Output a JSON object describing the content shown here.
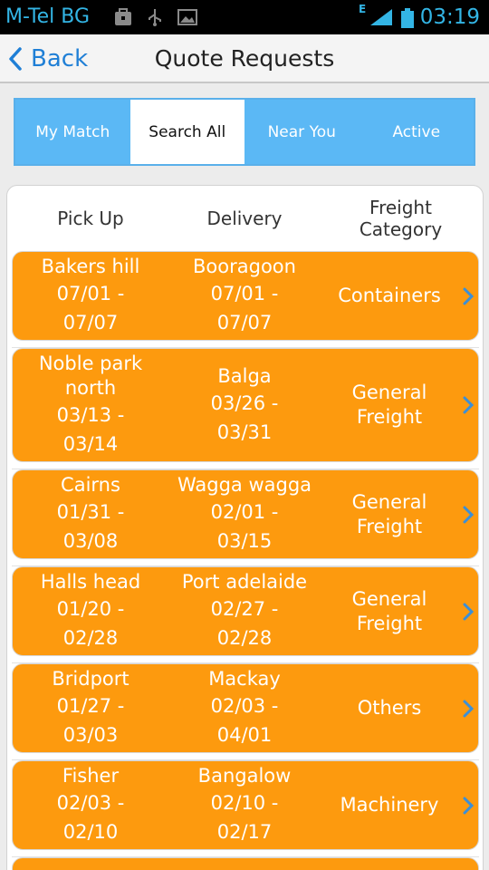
{
  "status_bar": {
    "carrier": "M-Tel BG",
    "time": "03:19",
    "network_type": "E",
    "icons": [
      "bag-icon",
      "usb-icon",
      "image-icon",
      "signal-icon",
      "battery-icon"
    ]
  },
  "header": {
    "back_label": "Back",
    "title": "Quote Requests"
  },
  "tabs": [
    {
      "label": "My Match",
      "active": false
    },
    {
      "label": "Search All",
      "active": true
    },
    {
      "label": "Near You",
      "active": false
    },
    {
      "label": "Active",
      "active": false
    }
  ],
  "columns": {
    "pick_up": "Pick Up",
    "delivery": "Delivery",
    "freight_category_line1": "Freight",
    "freight_category_line2": "Category"
  },
  "rows": [
    {
      "pick_place": "Bakers hill",
      "pick_dates_1": "07/01 -",
      "pick_dates_2": "07/07",
      "deliv_place": "Booragoon",
      "deliv_dates_1": "07/01 -",
      "deliv_dates_2": "07/07",
      "category": "Containers"
    },
    {
      "pick_place": "Noble park north",
      "pick_dates_1": "03/13 -",
      "pick_dates_2": "03/14",
      "deliv_place": "Balga",
      "deliv_dates_1": "03/26 -",
      "deliv_dates_2": "03/31",
      "category": "General Freight"
    },
    {
      "pick_place": "Cairns",
      "pick_dates_1": "01/31 -",
      "pick_dates_2": "03/08",
      "deliv_place": "Wagga wagga",
      "deliv_dates_1": "02/01 -",
      "deliv_dates_2": "03/15",
      "category": "General Freight"
    },
    {
      "pick_place": "Halls head",
      "pick_dates_1": "01/20 -",
      "pick_dates_2": "02/28",
      "deliv_place": "Port adelaide",
      "deliv_dates_1": "02/27 -",
      "deliv_dates_2": "02/28",
      "category": "General Freight"
    },
    {
      "pick_place": "Bridport",
      "pick_dates_1": "01/27 -",
      "pick_dates_2": "03/03",
      "deliv_place": "Mackay",
      "deliv_dates_1": "02/03 -",
      "deliv_dates_2": "04/01",
      "category": "Others"
    },
    {
      "pick_place": "Fisher",
      "pick_dates_1": "02/03 -",
      "pick_dates_2": "02/10",
      "deliv_place": "Bangalow",
      "deliv_dates_1": "02/10 -",
      "deliv_dates_2": "02/17",
      "category": "Machinery"
    }
  ],
  "colors": {
    "accent_blue": "#5bb8f5",
    "row_orange": "#fd9a0e",
    "link_blue": "#1f7fd6",
    "status_blue": "#33b5e5"
  }
}
